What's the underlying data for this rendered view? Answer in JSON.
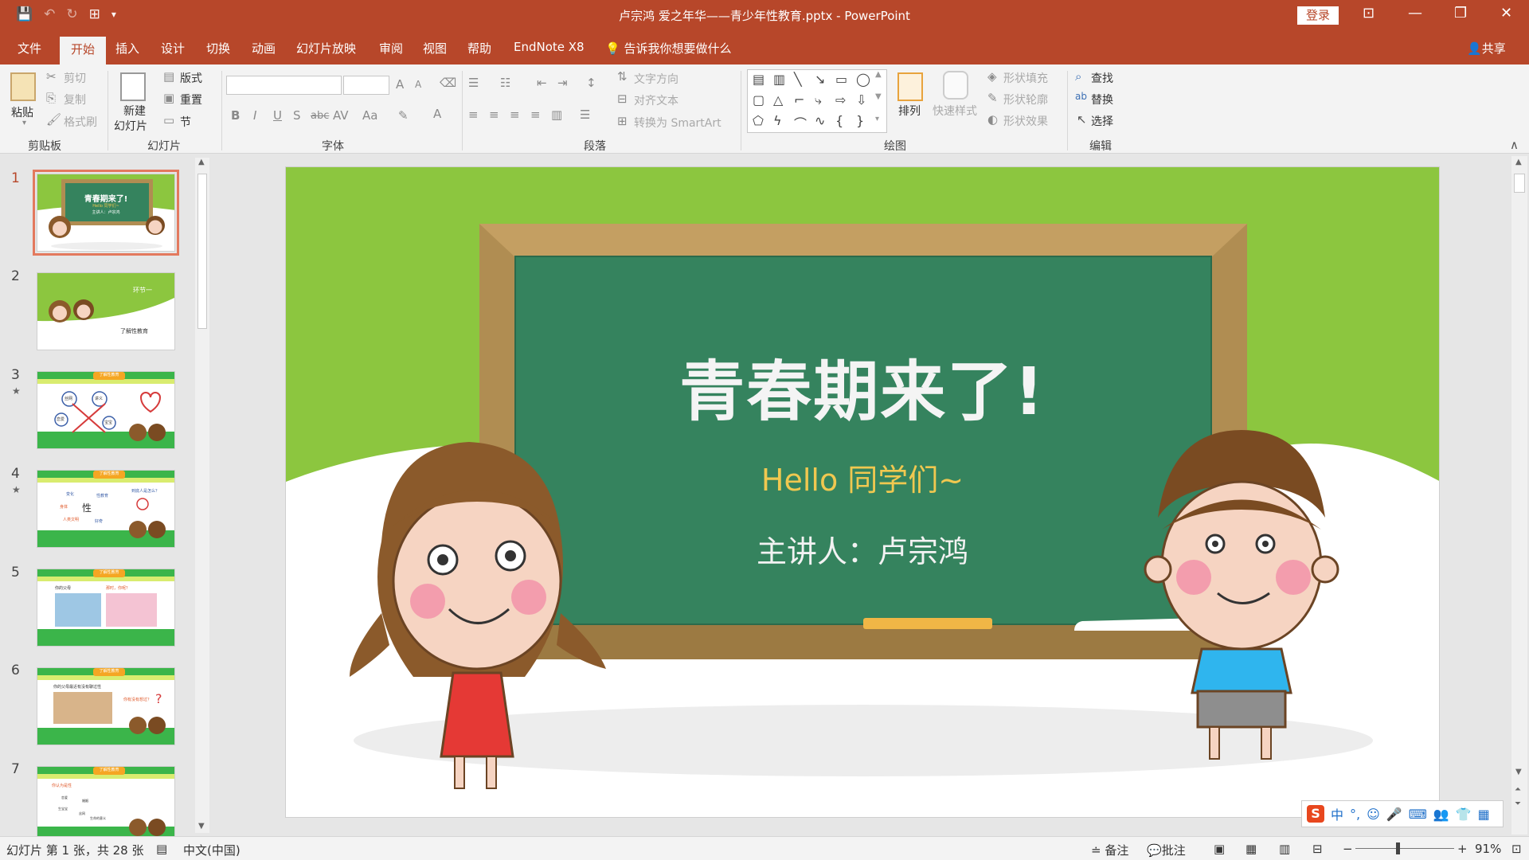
{
  "window": {
    "title": "卢宗鸿 爱之年华——青少年性教育.pptx  -  PowerPoint",
    "login_label": "登录",
    "controls": {
      "ribbon_display": "⊡",
      "minimize": "—",
      "restore": "❐",
      "close": "✕"
    }
  },
  "qat": {
    "save": "💾",
    "undo": "↶",
    "redo": "↻",
    "present": "⊞",
    "more": "▾"
  },
  "tabs": {
    "items": [
      "文件",
      "开始",
      "插入",
      "设计",
      "切换",
      "动画",
      "幻灯片放映",
      "审阅",
      "视图",
      "帮助",
      "EndNote X8"
    ],
    "active": "开始",
    "tell_me": "告诉我你想要做什么",
    "share": "共享"
  },
  "ribbon": {
    "clipboard": {
      "paste": "粘贴",
      "cut": "剪切",
      "copy": "复制",
      "format_painter": "格式刷",
      "label": "剪贴板"
    },
    "slides": {
      "new_slide_1": "新建",
      "new_slide_2": "幻灯片",
      "layout": "版式",
      "reset": "重置",
      "section": "节",
      "label": "幻灯片"
    },
    "font": {
      "label": "字体",
      "bold": "B",
      "italic": "I",
      "underline": "U",
      "shadow": "S",
      "strike": "abc",
      "spacing": "AV",
      "case": "Aa",
      "grow": "A",
      "shrink": "A",
      "color": "A"
    },
    "paragraph": {
      "text_direction": "文字方向",
      "align_text": "对齐文本",
      "smartart": "转换为 SmartArt",
      "label": "段落"
    },
    "drawing": {
      "arrange": "排列",
      "quick_styles": "快速样式",
      "shape_fill": "形状填充",
      "shape_outline": "形状轮廓",
      "shape_effects": "形状效果",
      "label": "绘图"
    },
    "editing": {
      "find": "查找",
      "replace": "替换",
      "select": "选择",
      "label": "编辑"
    },
    "collapse": "∧"
  },
  "thumbnails": {
    "numbers": [
      "1",
      "2",
      "3",
      "4",
      "5",
      "6",
      "7"
    ],
    "active_index": 0,
    "starred": [
      2,
      3
    ],
    "t1_title": "青春期来了!",
    "t1_sub": "Hello 同学们~",
    "t1_presenter": "主讲人：卢宗鸿",
    "t2_section": "环节一",
    "t2_caption": "了解性教育",
    "header_badge": "了解性教育",
    "t3_words": [
      "丝网",
      "讲义",
      "恋爱",
      "宝宝"
    ],
    "t4_center": "性",
    "t4_words": [
      "变化",
      "性教育",
      "身体",
      "人类文明",
      "好奇"
    ],
    "t4_question": "到底人是怎么？",
    "t5_left": "你的父母",
    "t5_right": "那时，你呢？",
    "t6_left": "你的父母最近有没有聊过性",
    "t6_right": "你有没有想过？",
    "t7_title": "你认为是性",
    "t7_words": [
      "恋爱",
      "婚姻",
      "生宝宝",
      "丝网",
      "生命的意义"
    ]
  },
  "slide": {
    "title": "青春期来了!",
    "subtitle": "Hello 同学们~",
    "presenter": "主讲人：卢宗鸿"
  },
  "ime": {
    "logo": "S",
    "mode": "中",
    "punct": "°,",
    "emoji": "☺",
    "mic": "🎤",
    "keyboard": "⌨",
    "user": "👥",
    "skin": "👕",
    "apps": "▦"
  },
  "status": {
    "slide_info": "幻灯片 第 1 张，共 28 张",
    "language": "中文(中国)",
    "notes": "备注",
    "comments": "批注",
    "zoom_minus": "−",
    "zoom_plus": "+",
    "zoom": "91%",
    "fit": "⊡"
  },
  "colors": {
    "accent": "#b7472a",
    "slide_green": "#8cc63f",
    "chalkboard": "#35835e",
    "frame": "#b08d52",
    "subtitle_yellow": "#f0c850"
  }
}
